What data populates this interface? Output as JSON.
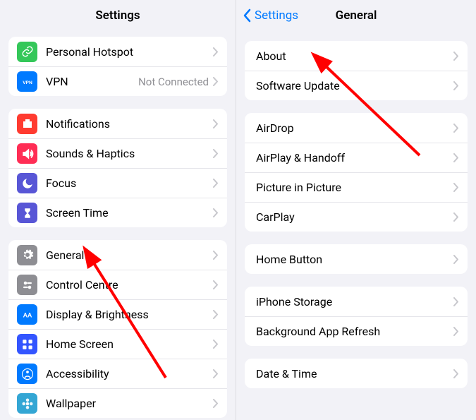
{
  "left": {
    "title": "Settings",
    "group1": [
      {
        "id": "personal-hotspot",
        "label": "Personal Hotspot",
        "iconBg": "#34c759",
        "iconName": "link"
      },
      {
        "id": "vpn",
        "label": "VPN",
        "value": "Not Connected",
        "iconBg": "#007aff",
        "iconName": "vpn"
      }
    ],
    "group2": [
      {
        "id": "notifications",
        "label": "Notifications",
        "iconBg": "#ff3b30",
        "iconName": "bell"
      },
      {
        "id": "sounds",
        "label": "Sounds & Haptics",
        "iconBg": "#ff2d55",
        "iconName": "speaker"
      },
      {
        "id": "focus",
        "label": "Focus",
        "iconBg": "#5856d6",
        "iconName": "moon"
      },
      {
        "id": "screentime",
        "label": "Screen Time",
        "iconBg": "#5856d6",
        "iconName": "hourglass"
      }
    ],
    "group3": [
      {
        "id": "general",
        "label": "General",
        "iconBg": "#8e8e93",
        "iconName": "gear"
      },
      {
        "id": "controlcentre",
        "label": "Control Centre",
        "iconBg": "#8e8e93",
        "iconName": "switches"
      },
      {
        "id": "display",
        "label": "Display & Brightness",
        "iconBg": "#007aff",
        "iconName": "aa"
      },
      {
        "id": "homescreen",
        "label": "Home Screen",
        "iconBg": "#3355ff",
        "iconName": "grid"
      },
      {
        "id": "accessibility",
        "label": "Accessibility",
        "iconBg": "#007aff",
        "iconName": "person"
      },
      {
        "id": "wallpaper",
        "label": "Wallpaper",
        "iconBg": "#33a6d4",
        "iconName": "flower"
      }
    ]
  },
  "right": {
    "back": "Settings",
    "title": "General",
    "group1": [
      "About",
      "Software Update"
    ],
    "group2": [
      "AirDrop",
      "AirPlay & Handoff",
      "Picture in Picture",
      "CarPlay"
    ],
    "group3": [
      "Home Button"
    ],
    "group4": [
      "iPhone Storage",
      "Background App Refresh"
    ],
    "group5": [
      "Date & Time"
    ]
  },
  "annotationColor": "#ff0000"
}
